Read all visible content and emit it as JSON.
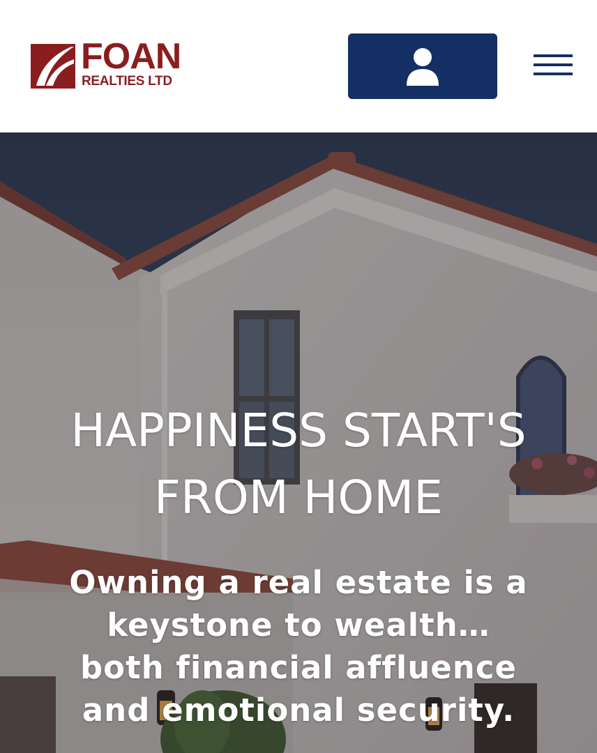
{
  "header": {
    "logo": {
      "name": "FOAN",
      "subtitle": "REALTIES LTD",
      "brand_color": "#8b1d1f"
    },
    "account_button": {
      "icon": "user-icon",
      "color": "#132f63"
    },
    "menu_button": {
      "icon": "hamburger-menu-icon"
    }
  },
  "hero": {
    "title": "HAPPINESS START'S FROM HOME",
    "subtitle": "Owning a real estate is a keystone to wealth… both financial affluence and emotional security."
  }
}
